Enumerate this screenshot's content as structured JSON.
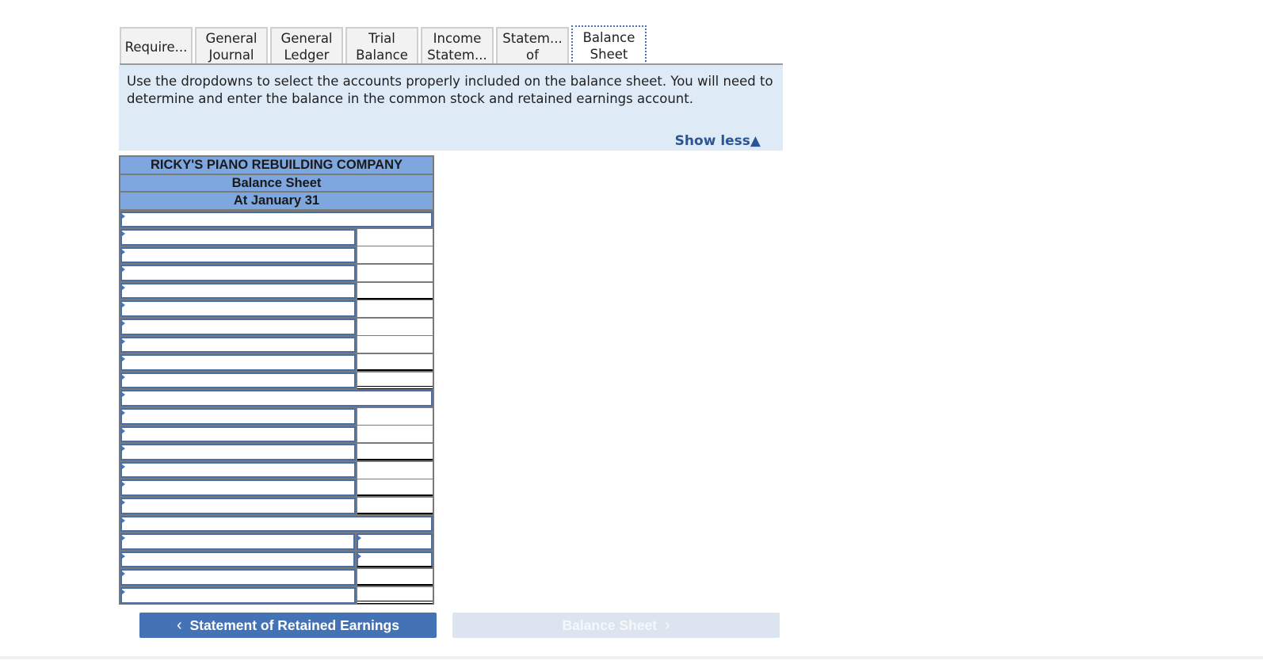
{
  "tabs": [
    {
      "label": "Require...",
      "active": false
    },
    {
      "label": "General Journal",
      "active": false
    },
    {
      "label": "General Ledger",
      "active": false
    },
    {
      "label": "Trial Balance",
      "active": false
    },
    {
      "label": "Income Statem...",
      "active": false
    },
    {
      "label": "Statem... of",
      "active": false
    },
    {
      "label": "Balance Sheet",
      "active": true
    }
  ],
  "tab_lines": [
    [
      "Require..."
    ],
    [
      "General",
      "Journal"
    ],
    [
      "General",
      "Ledger"
    ],
    [
      "Trial",
      "Balance"
    ],
    [
      "Income",
      "Statem..."
    ],
    [
      "Statem...",
      "of"
    ],
    [
      "Balance",
      "Sheet"
    ]
  ],
  "instructions": {
    "text": "Use the dropdowns to select the accounts properly included on the balance sheet. You will need to determine and enter the balance in the common stock and retained earnings account.",
    "toggle_label": "Show less",
    "toggle_icon": "▲"
  },
  "balance_sheet": {
    "company": "RICKY'S PIANO REBUILDING COMPANY",
    "title": "Balance Sheet",
    "date": "At January 31",
    "rows": [
      {
        "type": "full",
        "value": ""
      },
      {
        "type": "pair",
        "account": "",
        "amount": ""
      },
      {
        "type": "pair",
        "account": "",
        "amount": ""
      },
      {
        "type": "pair",
        "account": "",
        "amount": ""
      },
      {
        "type": "pair",
        "account": "",
        "amount": "",
        "amount_style": "line-bottom"
      },
      {
        "type": "pair",
        "account": "",
        "amount": ""
      },
      {
        "type": "pair",
        "account": "",
        "amount": ""
      },
      {
        "type": "pair",
        "account": "",
        "amount": ""
      },
      {
        "type": "pair",
        "account": "",
        "amount": "",
        "amount_style": "line-bottom"
      },
      {
        "type": "pair",
        "account": "",
        "amount": "",
        "amount_style": "dbl-bottom"
      },
      {
        "type": "full",
        "value": ""
      },
      {
        "type": "pair",
        "account": "",
        "amount": ""
      },
      {
        "type": "pair",
        "account": "",
        "amount": ""
      },
      {
        "type": "pair",
        "account": "",
        "amount": "",
        "amount_style": "line-bottom"
      },
      {
        "type": "pair",
        "account": "",
        "amount": ""
      },
      {
        "type": "pair",
        "account": "",
        "amount": "",
        "amount_style": "line-bottom"
      },
      {
        "type": "pair",
        "account": "",
        "amount": "",
        "amount_style": "line-bottom"
      },
      {
        "type": "full",
        "value": ""
      },
      {
        "type": "pair",
        "account": "",
        "amount": "",
        "amount_dropdown": true
      },
      {
        "type": "pair",
        "account": "",
        "amount": "",
        "amount_dropdown": true,
        "amount_style": "line-bottom"
      },
      {
        "type": "pair",
        "account": "",
        "amount": "",
        "amount_style": "line-bottom"
      },
      {
        "type": "pair",
        "account": "",
        "amount": "",
        "amount_style": "dbl-bottom"
      }
    ]
  },
  "navigation": {
    "prev_label": "Statement of Retained Earnings",
    "prev_icon": "‹",
    "next_label": "Balance Sheet",
    "next_icon": "›",
    "next_disabled": true
  },
  "colors": {
    "header_fill": "#7ea7df",
    "instruction_fill": "#dfeaf7",
    "prev_button": "#4473b5",
    "next_button_disabled": "#dce4ef",
    "dropdown_border": "#4a6fa5"
  }
}
